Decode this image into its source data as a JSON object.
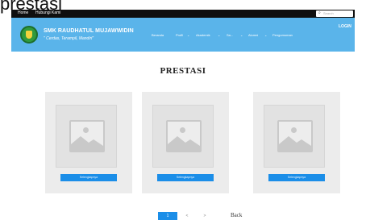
{
  "snippet": "prestasi",
  "topbar": {
    "links": [
      "Home",
      "Hubungi Kami"
    ],
    "search_placeholder": "Search",
    "search_icon": "search-icon"
  },
  "header": {
    "school_name": "SMK RAUDHATUL MUJAWWIDIN",
    "motto": "\" Cerdas, Terampil, Mandiri\"",
    "nav": [
      "Beranda",
      "Profil",
      "Akademik",
      "Sa...",
      "Alumni",
      "Pengumuman"
    ],
    "login": "LOGIN",
    "colors": {
      "header_bg": "#5ab4ea",
      "topbar_bg": "#0f0f0f"
    }
  },
  "main": {
    "title": "PRESTASI",
    "cards": [
      {
        "button_label": "Selengkapnya"
      },
      {
        "button_label": "Selengkapnya"
      },
      {
        "button_label": "Selengkapnya"
      }
    ],
    "accent": "#1b8ee8"
  },
  "pagination": {
    "pages": [
      "1",
      "<",
      ">"
    ],
    "active_page": "1",
    "back_label": "Back"
  }
}
